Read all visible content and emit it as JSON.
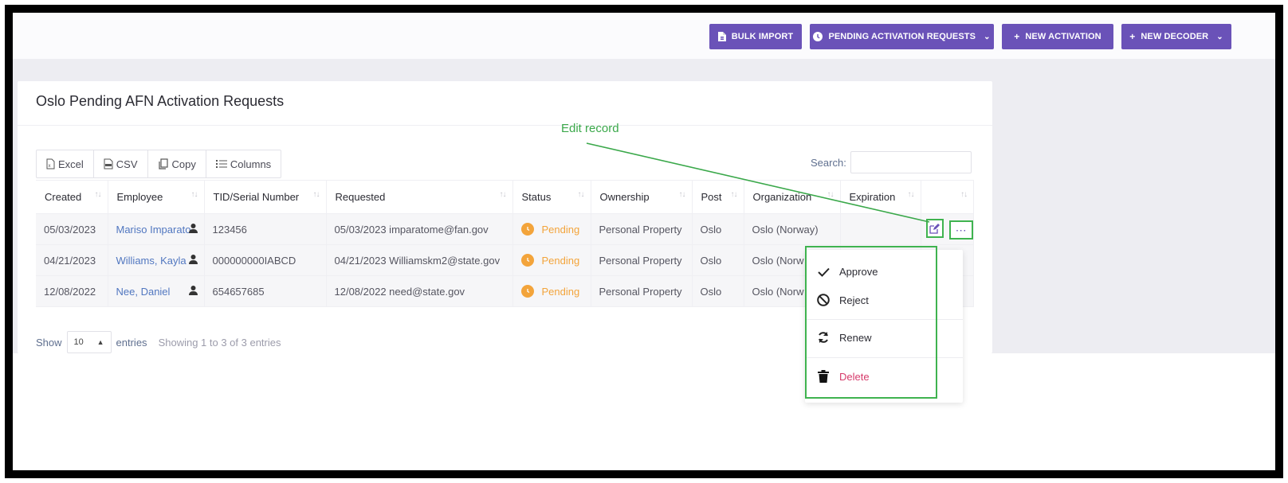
{
  "toolbar": {
    "bulk_import": "BULK IMPORT",
    "pending_requests": "PENDING ACTIVATION REQUESTS",
    "new_activation": "NEW ACTIVATION",
    "new_decoder": "NEW DECODER"
  },
  "card": {
    "title": "Oslo Pending AFN Activation Requests"
  },
  "export_buttons": {
    "excel": "Excel",
    "csv": "CSV",
    "copy": "Copy",
    "columns": "Columns"
  },
  "search": {
    "label": "Search:",
    "value": ""
  },
  "table": {
    "headers": [
      "Created",
      "Employee",
      "TID/Serial Number",
      "Requested",
      "Status",
      "Ownership",
      "Post",
      "Organization",
      "Expiration",
      ""
    ],
    "rows": [
      {
        "created": "05/03/2023",
        "employee": "Mariso Imparato",
        "serial": "123456",
        "requested": "05/03/2023 imparatome@fan.gov",
        "status": "Pending",
        "ownership": "Personal Property",
        "post": "Oslo",
        "organization": "Oslo (Norway)",
        "expiration": ""
      },
      {
        "created": "04/21/2023",
        "employee": "Williams, Kayla",
        "serial": "000000000IABCD",
        "requested": "04/21/2023 Williamskm2@state.gov",
        "status": "Pending",
        "ownership": "Personal Property",
        "post": "Oslo",
        "organization": "Oslo (Norw",
        "expiration": ""
      },
      {
        "created": "12/08/2022",
        "employee": "Nee, Daniel",
        "serial": "654657685",
        "requested": "12/08/2022 need@state.gov",
        "status": "Pending",
        "ownership": "Personal Property",
        "post": "Oslo",
        "organization": "Oslo (Norw",
        "expiration": ""
      }
    ]
  },
  "footer": {
    "show": "Show",
    "page_length": "10",
    "entries": "entries",
    "info": "Showing 1 to 3 of 3 entries"
  },
  "dropdown": {
    "approve": "Approve",
    "reject": "Reject",
    "renew": "Renew",
    "delete": "Delete"
  },
  "annotation": {
    "label": "Edit record"
  },
  "colors": {
    "primary": "#6a52b8",
    "pending": "#f3a43b",
    "link": "#5177c0",
    "annotation": "#3fb34f",
    "delete": "#d63a6a"
  }
}
